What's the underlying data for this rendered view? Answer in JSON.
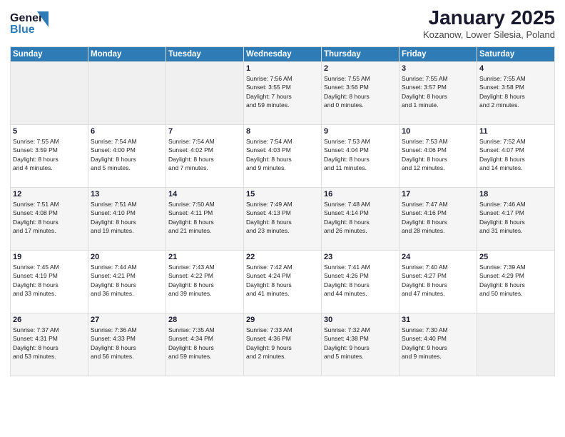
{
  "logo": {
    "line1": "General",
    "line2": "Blue"
  },
  "title": "January 2025",
  "subtitle": "Kozanow, Lower Silesia, Poland",
  "days_header": [
    "Sunday",
    "Monday",
    "Tuesday",
    "Wednesday",
    "Thursday",
    "Friday",
    "Saturday"
  ],
  "weeks": [
    [
      {
        "day": "",
        "info": ""
      },
      {
        "day": "",
        "info": ""
      },
      {
        "day": "",
        "info": ""
      },
      {
        "day": "1",
        "info": "Sunrise: 7:56 AM\nSunset: 3:55 PM\nDaylight: 7 hours\nand 59 minutes."
      },
      {
        "day": "2",
        "info": "Sunrise: 7:55 AM\nSunset: 3:56 PM\nDaylight: 8 hours\nand 0 minutes."
      },
      {
        "day": "3",
        "info": "Sunrise: 7:55 AM\nSunset: 3:57 PM\nDaylight: 8 hours\nand 1 minute."
      },
      {
        "day": "4",
        "info": "Sunrise: 7:55 AM\nSunset: 3:58 PM\nDaylight: 8 hours\nand 2 minutes."
      }
    ],
    [
      {
        "day": "5",
        "info": "Sunrise: 7:55 AM\nSunset: 3:59 PM\nDaylight: 8 hours\nand 4 minutes."
      },
      {
        "day": "6",
        "info": "Sunrise: 7:54 AM\nSunset: 4:00 PM\nDaylight: 8 hours\nand 5 minutes."
      },
      {
        "day": "7",
        "info": "Sunrise: 7:54 AM\nSunset: 4:02 PM\nDaylight: 8 hours\nand 7 minutes."
      },
      {
        "day": "8",
        "info": "Sunrise: 7:54 AM\nSunset: 4:03 PM\nDaylight: 8 hours\nand 9 minutes."
      },
      {
        "day": "9",
        "info": "Sunrise: 7:53 AM\nSunset: 4:04 PM\nDaylight: 8 hours\nand 11 minutes."
      },
      {
        "day": "10",
        "info": "Sunrise: 7:53 AM\nSunset: 4:06 PM\nDaylight: 8 hours\nand 12 minutes."
      },
      {
        "day": "11",
        "info": "Sunrise: 7:52 AM\nSunset: 4:07 PM\nDaylight: 8 hours\nand 14 minutes."
      }
    ],
    [
      {
        "day": "12",
        "info": "Sunrise: 7:51 AM\nSunset: 4:08 PM\nDaylight: 8 hours\nand 17 minutes."
      },
      {
        "day": "13",
        "info": "Sunrise: 7:51 AM\nSunset: 4:10 PM\nDaylight: 8 hours\nand 19 minutes."
      },
      {
        "day": "14",
        "info": "Sunrise: 7:50 AM\nSunset: 4:11 PM\nDaylight: 8 hours\nand 21 minutes."
      },
      {
        "day": "15",
        "info": "Sunrise: 7:49 AM\nSunset: 4:13 PM\nDaylight: 8 hours\nand 23 minutes."
      },
      {
        "day": "16",
        "info": "Sunrise: 7:48 AM\nSunset: 4:14 PM\nDaylight: 8 hours\nand 26 minutes."
      },
      {
        "day": "17",
        "info": "Sunrise: 7:47 AM\nSunset: 4:16 PM\nDaylight: 8 hours\nand 28 minutes."
      },
      {
        "day": "18",
        "info": "Sunrise: 7:46 AM\nSunset: 4:17 PM\nDaylight: 8 hours\nand 31 minutes."
      }
    ],
    [
      {
        "day": "19",
        "info": "Sunrise: 7:45 AM\nSunset: 4:19 PM\nDaylight: 8 hours\nand 33 minutes."
      },
      {
        "day": "20",
        "info": "Sunrise: 7:44 AM\nSunset: 4:21 PM\nDaylight: 8 hours\nand 36 minutes."
      },
      {
        "day": "21",
        "info": "Sunrise: 7:43 AM\nSunset: 4:22 PM\nDaylight: 8 hours\nand 39 minutes."
      },
      {
        "day": "22",
        "info": "Sunrise: 7:42 AM\nSunset: 4:24 PM\nDaylight: 8 hours\nand 41 minutes."
      },
      {
        "day": "23",
        "info": "Sunrise: 7:41 AM\nSunset: 4:26 PM\nDaylight: 8 hours\nand 44 minutes."
      },
      {
        "day": "24",
        "info": "Sunrise: 7:40 AM\nSunset: 4:27 PM\nDaylight: 8 hours\nand 47 minutes."
      },
      {
        "day": "25",
        "info": "Sunrise: 7:39 AM\nSunset: 4:29 PM\nDaylight: 8 hours\nand 50 minutes."
      }
    ],
    [
      {
        "day": "26",
        "info": "Sunrise: 7:37 AM\nSunset: 4:31 PM\nDaylight: 8 hours\nand 53 minutes."
      },
      {
        "day": "27",
        "info": "Sunrise: 7:36 AM\nSunset: 4:33 PM\nDaylight: 8 hours\nand 56 minutes."
      },
      {
        "day": "28",
        "info": "Sunrise: 7:35 AM\nSunset: 4:34 PM\nDaylight: 8 hours\nand 59 minutes."
      },
      {
        "day": "29",
        "info": "Sunrise: 7:33 AM\nSunset: 4:36 PM\nDaylight: 9 hours\nand 2 minutes."
      },
      {
        "day": "30",
        "info": "Sunrise: 7:32 AM\nSunset: 4:38 PM\nDaylight: 9 hours\nand 5 minutes."
      },
      {
        "day": "31",
        "info": "Sunrise: 7:30 AM\nSunset: 4:40 PM\nDaylight: 9 hours\nand 9 minutes."
      },
      {
        "day": "",
        "info": ""
      }
    ]
  ]
}
